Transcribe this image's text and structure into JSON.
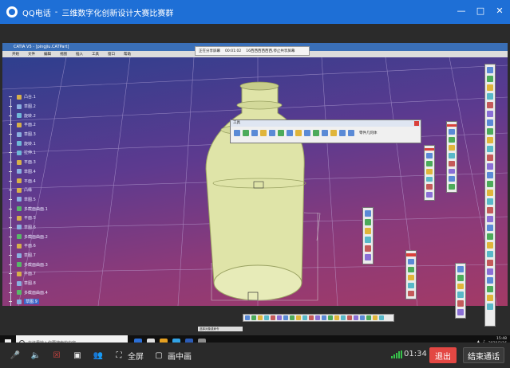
{
  "qq": {
    "app": "QQ电话",
    "separator": "-",
    "group": "三维数字化创新设计大赛比赛群",
    "controls": {
      "fullscreen": "全屏",
      "pip": "画中画",
      "timer": "01:34",
      "exit": "退出",
      "end_call": "结束通话"
    }
  },
  "catia": {
    "window_title": "CATIA V5 - [pingjiu.CATPart]",
    "menu": [
      "开始",
      "文件",
      "编辑",
      "视图",
      "插入",
      "工具",
      "窗口",
      "帮助"
    ],
    "meeting_bar": [
      "正在分享屏幕",
      "00:01:02",
      "16西西西西西西,停止共享屏幕"
    ],
    "tools_panel_title": "工具",
    "tools_panel_label": "零件几何体",
    "status_text": "选择对象或命令",
    "tree": [
      {
        "label": "凸台.1",
        "color": "#d6b04a"
      },
      {
        "label": "草图.2",
        "color": "#8ab0e0"
      },
      {
        "label": "旋转.2",
        "color": "#6fb9d8"
      },
      {
        "label": "平面.2",
        "color": "#d6b04a"
      },
      {
        "label": "草图.3",
        "color": "#8ab0e0"
      },
      {
        "label": "旋转.1",
        "color": "#6fb9d8"
      },
      {
        "label": "拉伸.1",
        "color": "#6fb9d8"
      },
      {
        "label": "平面.3",
        "color": "#d6b04a"
      },
      {
        "label": "草图.4",
        "color": "#8ab0e0"
      },
      {
        "label": "平面.4",
        "color": "#d6b04a"
      },
      {
        "label": "凸缘",
        "color": "#d6b04a"
      },
      {
        "label": "草图.5",
        "color": "#8ab0e0"
      },
      {
        "label": "多截面曲面.1",
        "color": "#58b868"
      },
      {
        "label": "平面.5",
        "color": "#d6b04a"
      },
      {
        "label": "草图.6",
        "color": "#8ab0e0"
      },
      {
        "label": "多截面曲面.2",
        "color": "#58b868"
      },
      {
        "label": "平面.6",
        "color": "#d6b04a"
      },
      {
        "label": "草图.7",
        "color": "#8ab0e0"
      },
      {
        "label": "多截面曲面.3",
        "color": "#58b868"
      },
      {
        "label": "平面.7",
        "color": "#d6b04a"
      },
      {
        "label": "草图.8",
        "color": "#8ab0e0"
      },
      {
        "label": "多截面曲面.4",
        "color": "#58b868"
      },
      {
        "label": "草图.9",
        "color": "#8ab0e0"
      }
    ]
  },
  "taskbar": {
    "search_placeholder": "在这里输入你要搜索的内容",
    "time": "15:48",
    "date": "2020/2/16"
  },
  "colors": {
    "qq_blue": "#1e6fd6",
    "exit_red": "#e34743",
    "model": "#dfe4a8"
  }
}
